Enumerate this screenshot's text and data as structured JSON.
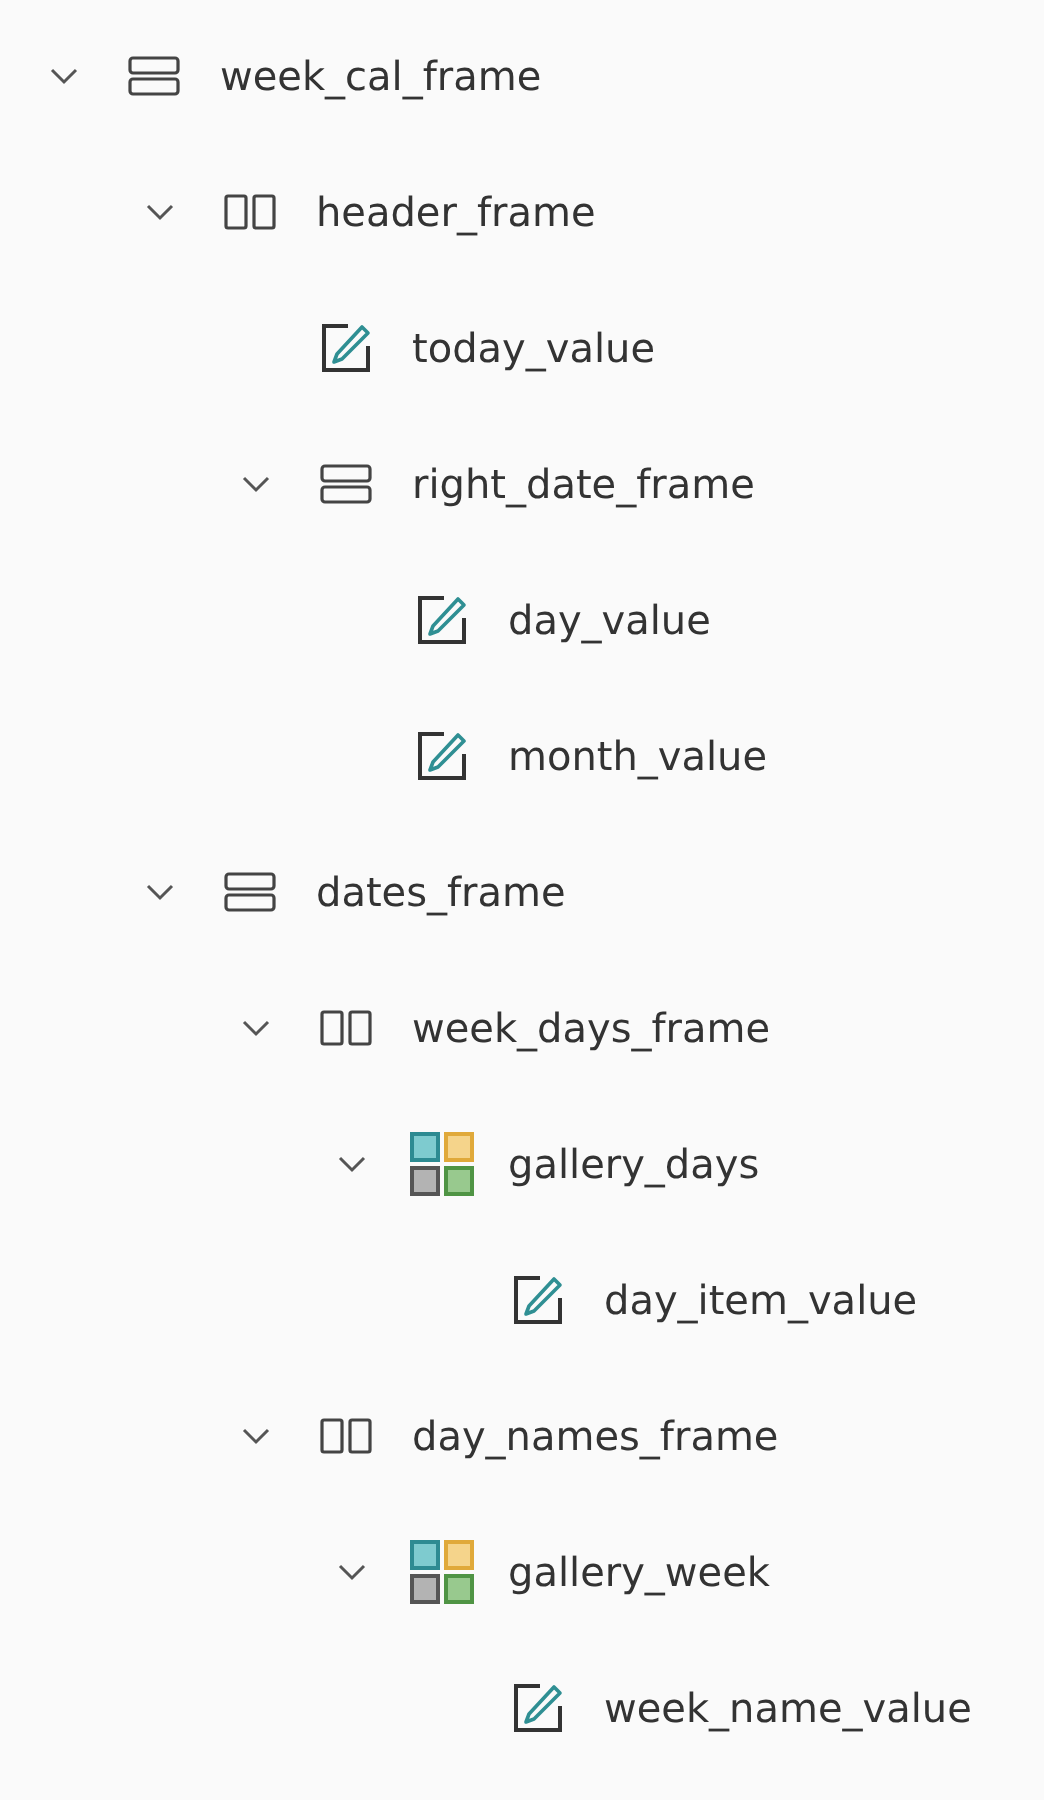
{
  "tree": [
    {
      "label": "week_cal_frame",
      "kind": "vertical",
      "expanded": true,
      "children": [
        {
          "label": "header_frame",
          "kind": "horizontal",
          "expanded": true,
          "children": [
            {
              "label": "today_value",
              "kind": "label"
            },
            {
              "label": "right_date_frame",
              "kind": "vertical",
              "expanded": true,
              "children": [
                {
                  "label": "day_value",
                  "kind": "label"
                },
                {
                  "label": "month_value",
                  "kind": "label"
                }
              ]
            }
          ]
        },
        {
          "label": "dates_frame",
          "kind": "vertical",
          "expanded": true,
          "children": [
            {
              "label": "week_days_frame",
              "kind": "horizontal",
              "expanded": true,
              "children": [
                {
                  "label": "gallery_days",
                  "kind": "gallery",
                  "expanded": true,
                  "children": [
                    {
                      "label": "day_item_value",
                      "kind": "label"
                    }
                  ]
                }
              ]
            },
            {
              "label": "day_names_frame",
              "kind": "horizontal",
              "expanded": true,
              "children": [
                {
                  "label": "gallery_week",
                  "kind": "gallery",
                  "expanded": true,
                  "children": [
                    {
                      "label": "week_name_value",
                      "kind": "label"
                    }
                  ]
                }
              ]
            }
          ]
        }
      ]
    }
  ]
}
